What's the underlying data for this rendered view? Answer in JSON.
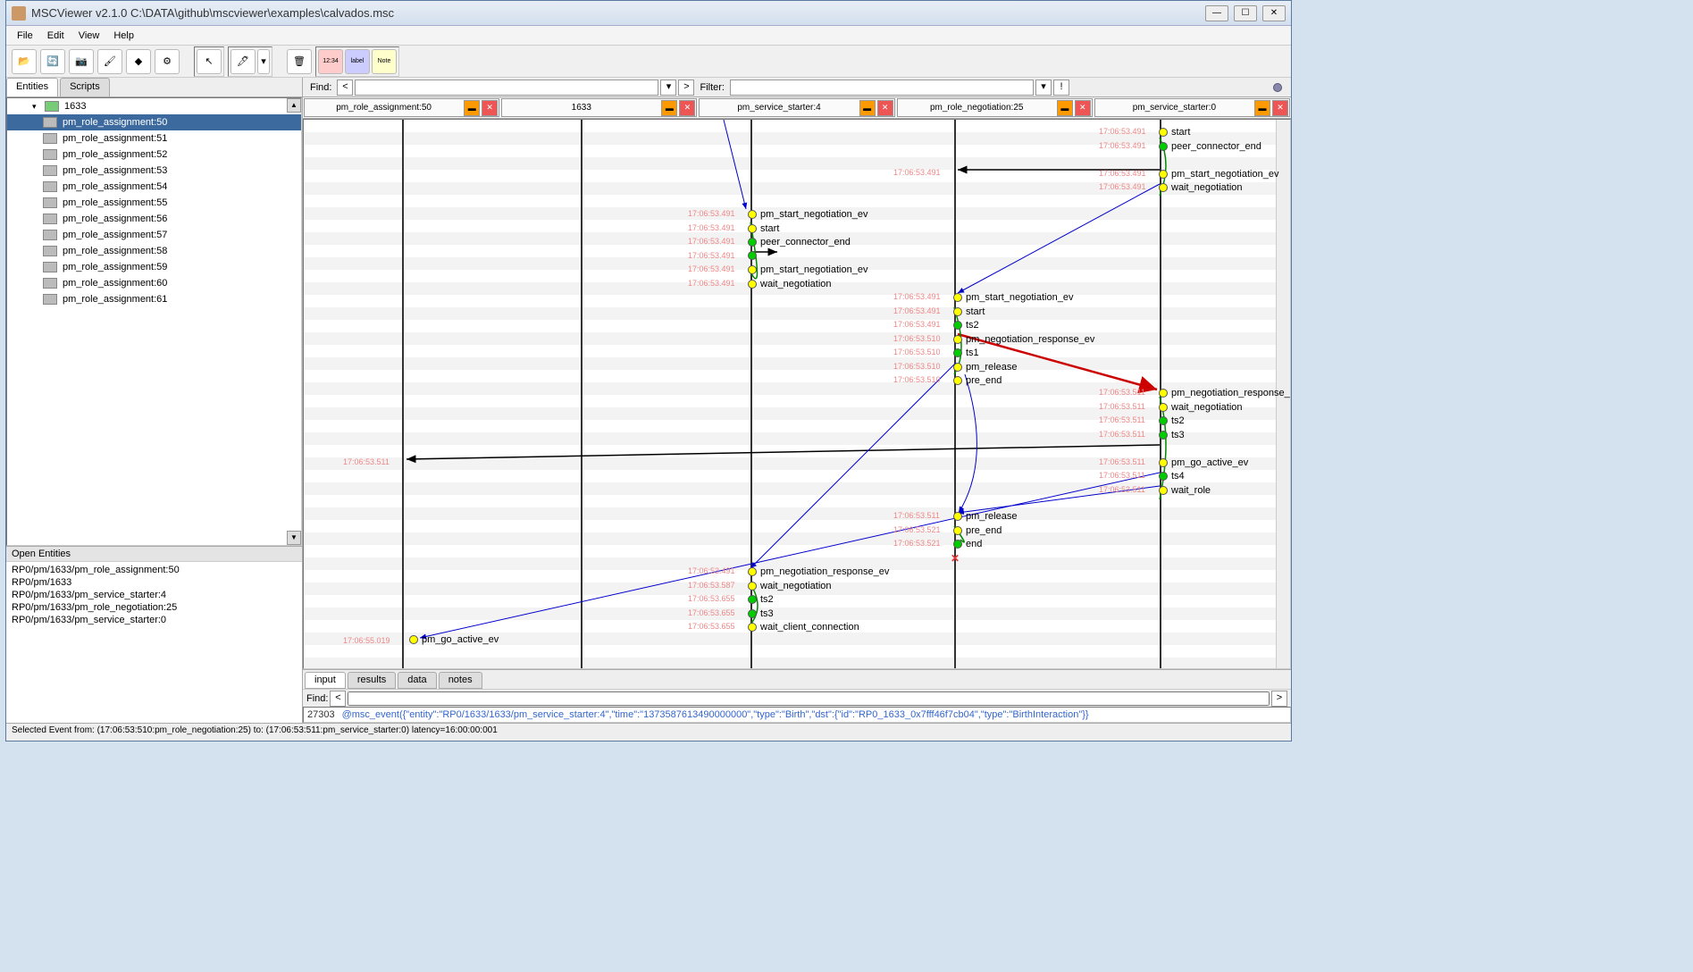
{
  "title": "MSCViewer v2.1.0        C:\\DATA\\github\\mscviewer\\examples\\calvados.msc",
  "menu": [
    "File",
    "Edit",
    "View",
    "Help"
  ],
  "tabs": {
    "entities": "Entities",
    "scripts": "Scripts"
  },
  "tree": {
    "root": "1633",
    "items": [
      "pm_role_assignment:50",
      "pm_role_assignment:51",
      "pm_role_assignment:52",
      "pm_role_assignment:53",
      "pm_role_assignment:54",
      "pm_role_assignment:55",
      "pm_role_assignment:56",
      "pm_role_assignment:57",
      "pm_role_assignment:58",
      "pm_role_assignment:59",
      "pm_role_assignment:60",
      "pm_role_assignment:61"
    ]
  },
  "openEntities": {
    "header": "Open Entities",
    "items": [
      "RP0/pm/1633/pm_role_assignment:50",
      "RP0/pm/1633",
      "RP0/pm/1633/pm_service_starter:4",
      "RP0/pm/1633/pm_role_negotiation:25",
      "RP0/pm/1633/pm_service_starter:0"
    ]
  },
  "findLabel": "Find:",
  "filterLabel": "Filter:",
  "lanes": [
    "pm_role_assignment:50",
    "1633",
    "pm_service_starter:4",
    "pm_role_negotiation:25",
    "pm_service_starter:0"
  ],
  "events_ss4": [
    {
      "t": "17:06:53.491",
      "n": "pm_start_negotiation_ev",
      "c": "y"
    },
    {
      "t": "17:06:53.491",
      "n": "start",
      "c": "y"
    },
    {
      "t": "17:06:53.491",
      "n": "peer_connector_end",
      "c": "g"
    },
    {
      "t": "17:06:53.491",
      "n": "",
      "c": "g"
    },
    {
      "t": "17:06:53.491",
      "n": "pm_start_negotiation_ev",
      "c": "y"
    },
    {
      "t": "17:06:53.491",
      "n": "wait_negotiation",
      "c": "y"
    }
  ],
  "events_ss4_b": [
    {
      "t": "17:06:53.491",
      "n": "pm_negotiation_response_ev",
      "c": "y"
    },
    {
      "t": "17:06:53.587",
      "n": "wait_negotiation",
      "c": "y"
    },
    {
      "t": "17:06:53.655",
      "n": "ts2",
      "c": "g"
    },
    {
      "t": "17:06:53.655",
      "n": "ts3",
      "c": "g"
    },
    {
      "t": "17:06:53.655",
      "n": "wait_client_connection",
      "c": "y"
    }
  ],
  "events_rn25": [
    {
      "t": "17:06:53.491",
      "n": "pm_start_negotiation_ev",
      "c": "y"
    },
    {
      "t": "17:06:53.491",
      "n": "start",
      "c": "y"
    },
    {
      "t": "17:06:53.491",
      "n": "ts2",
      "c": "g"
    },
    {
      "t": "17:06:53.510",
      "n": "pm_negotiation_response_ev",
      "c": "y"
    },
    {
      "t": "17:06:53.510",
      "n": "ts1",
      "c": "g"
    },
    {
      "t": "17:06:53.510",
      "n": "pm_release",
      "c": "y"
    },
    {
      "t": "17:06:53.510",
      "n": "pre_end",
      "c": "y"
    }
  ],
  "events_rn25_b": [
    {
      "t": "17:06:53.511",
      "n": "pm_release",
      "c": "y"
    },
    {
      "t": "17:06:53.521",
      "n": "pre_end",
      "c": "y"
    },
    {
      "t": "17:06:53.521",
      "n": "end",
      "c": "g"
    }
  ],
  "events_ss0_a": [
    {
      "t": "17:06:53.491",
      "n": "start",
      "c": "y"
    },
    {
      "t": "17:06:53.491",
      "n": "peer_connector_end",
      "c": "g"
    },
    {
      "t": "",
      "n": "",
      "c": ""
    },
    {
      "t": "17:06:53.491",
      "n": "pm_start_negotiation_ev",
      "c": "y"
    },
    {
      "t": "17:06:53.491",
      "n": "wait_negotiation",
      "c": "y"
    }
  ],
  "events_ss0_b": [
    {
      "t": "17:06:53.511",
      "n": "pm_negotiation_response_ev",
      "c": "y"
    },
    {
      "t": "17:06:53.511",
      "n": "wait_negotiation",
      "c": "y"
    },
    {
      "t": "17:06:53.511",
      "n": "ts2",
      "c": "g"
    },
    {
      "t": "17:06:53.511",
      "n": "ts3",
      "c": "g"
    },
    {
      "t": "",
      "n": "",
      "c": ""
    },
    {
      "t": "17:06:53.511",
      "n": "pm_go_active_ev",
      "c": "y"
    },
    {
      "t": "17:06:53.511",
      "n": "ts4",
      "c": "g"
    },
    {
      "t": "17:06:53.511",
      "n": "wait_role",
      "c": "y"
    }
  ],
  "ts_ra50": "17:06:53.511",
  "ts_ra50b": "17:06:55.019",
  "ev_ra50": "pm_go_active_ev",
  "ts_1633": "17:06:53.491",
  "bottomTabs": [
    "input",
    "results",
    "data",
    "notes"
  ],
  "log": {
    "line": "27303",
    "text": "@msc_event({\"entity\":\"RP0/1633/1633/pm_service_starter:4\",\"time\":\"1373587613490000000\",\"type\":\"Birth\",\"dst\":{\"id\":\"RP0_1633_0x7fff46f7cb04\",\"type\":\"BirthInteraction\"}}"
  },
  "status": "Selected Event from: (17:06:53:510:pm_role_negotiation:25) to: (17:06:53:511:pm_service_starter:0) latency=16:00:00:001"
}
